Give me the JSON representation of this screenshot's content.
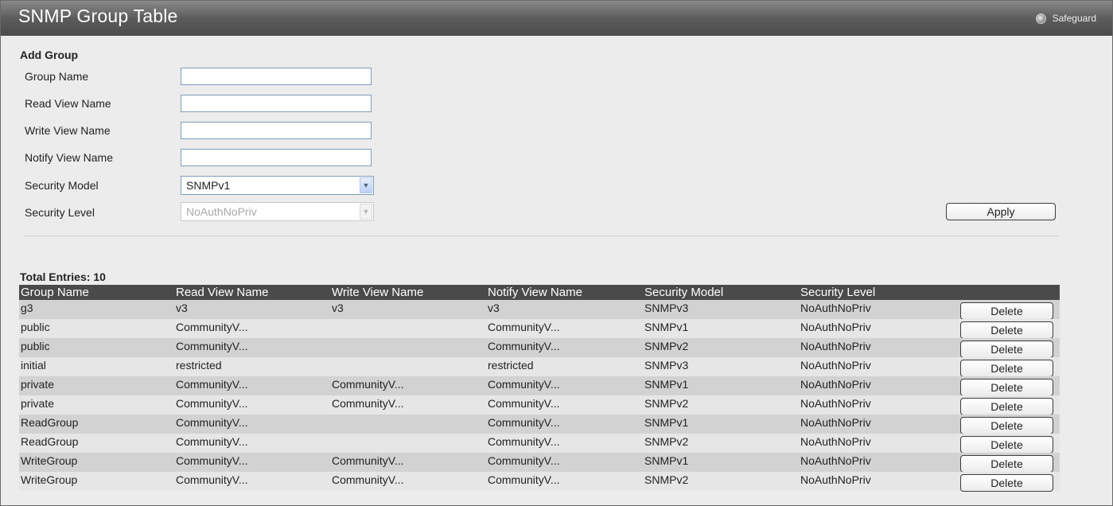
{
  "header": {
    "title": "SNMP Group Table",
    "safeguard": "Safeguard"
  },
  "form": {
    "section_title": "Add Group",
    "fields": {
      "group_name": {
        "label": "Group Name",
        "value": ""
      },
      "read_view_name": {
        "label": "Read View Name",
        "value": ""
      },
      "write_view_name": {
        "label": "Write View Name",
        "value": ""
      },
      "notify_view_name": {
        "label": "Notify View Name",
        "value": ""
      },
      "security_model": {
        "label": "Security Model",
        "value": "SNMPv1"
      },
      "security_level": {
        "label": "Security Level",
        "value": "NoAuthNoPriv"
      }
    },
    "apply_label": "Apply"
  },
  "table": {
    "total_label": "Total Entries:",
    "total_value": "10",
    "columns": [
      "Group Name",
      "Read View Name",
      "Write View Name",
      "Notify View Name",
      "Security Model",
      "Security Level"
    ],
    "delete_label": "Delete",
    "rows": [
      [
        "g3",
        "v3",
        "v3",
        "v3",
        "SNMPv3",
        "NoAuthNoPriv"
      ],
      [
        "public",
        "CommunityV...",
        "",
        "CommunityV...",
        "SNMPv1",
        "NoAuthNoPriv"
      ],
      [
        "public",
        "CommunityV...",
        "",
        "CommunityV...",
        "SNMPv2",
        "NoAuthNoPriv"
      ],
      [
        "initial",
        "restricted",
        "",
        "restricted",
        "SNMPv3",
        "NoAuthNoPriv"
      ],
      [
        "private",
        "CommunityV...",
        "CommunityV...",
        "CommunityV...",
        "SNMPv1",
        "NoAuthNoPriv"
      ],
      [
        "private",
        "CommunityV...",
        "CommunityV...",
        "CommunityV...",
        "SNMPv2",
        "NoAuthNoPriv"
      ],
      [
        "ReadGroup",
        "CommunityV...",
        "",
        "CommunityV...",
        "SNMPv1",
        "NoAuthNoPriv"
      ],
      [
        "ReadGroup",
        "CommunityV...",
        "",
        "CommunityV...",
        "SNMPv2",
        "NoAuthNoPriv"
      ],
      [
        "WriteGroup",
        "CommunityV...",
        "CommunityV...",
        "CommunityV...",
        "SNMPv1",
        "NoAuthNoPriv"
      ],
      [
        "WriteGroup",
        "CommunityV...",
        "CommunityV...",
        "CommunityV...",
        "SNMPv2",
        "NoAuthNoPriv"
      ]
    ]
  }
}
